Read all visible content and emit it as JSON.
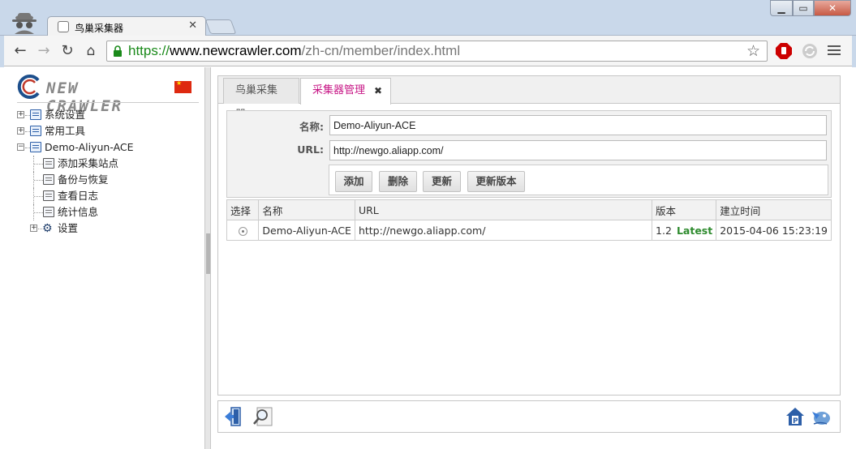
{
  "browser": {
    "tab_title": "鸟巢采集器",
    "url_scheme": "https://",
    "url_host": "www.newcrawler.com",
    "url_path": "/zh-cn/member/index.html",
    "close_glyph": "✕",
    "min_glyph": "▁",
    "max_glyph": "▭",
    "winclose_glyph": "✕"
  },
  "logo": {
    "text": "NEW CRAWLER"
  },
  "tree": {
    "items": [
      {
        "label": "系统设置",
        "expander": "+"
      },
      {
        "label": "常用工具",
        "expander": "+"
      },
      {
        "label": "Demo-Aliyun-ACE",
        "expander": "−"
      },
      {
        "label": "添加采集站点"
      },
      {
        "label": "备份与恢复"
      },
      {
        "label": "查看日志"
      },
      {
        "label": "统计信息"
      },
      {
        "label": "设置",
        "expander": "+"
      }
    ]
  },
  "main": {
    "tabs": [
      {
        "label": "鸟巢采集器"
      },
      {
        "label": "采集器管理",
        "close": "✖"
      }
    ],
    "form": {
      "name_label": "名称:",
      "name_value": "Demo-Aliyun-ACE",
      "url_label": "URL:",
      "url_value": "http://newgo.aliapp.com/"
    },
    "buttons": {
      "add": "添加",
      "delete": "删除",
      "update": "更新",
      "update_version": "更新版本"
    },
    "table": {
      "headers": [
        "选择",
        "名称",
        "URL",
        "版本",
        "建立时间"
      ],
      "rows": [
        {
          "name": "Demo-Aliyun-ACE",
          "url": "http://newgo.aliapp.com/",
          "version": "1.2",
          "version_tag": "Latest",
          "created": "2015-04-06 15:23:19"
        }
      ]
    }
  },
  "colors": {
    "active_tab": "#c71585",
    "latest": "#2e8b2e",
    "chrome_frame": "#c9d8ea"
  },
  "icons": [
    "incognito-icon",
    "back-icon",
    "forward-icon",
    "reload-icon",
    "home-icon",
    "lock-icon",
    "star-icon",
    "adblock-icon",
    "sync-icon",
    "menu-icon",
    "exit-icon",
    "search-icon",
    "home-p-icon",
    "bird-icon",
    "gear-icon"
  ]
}
